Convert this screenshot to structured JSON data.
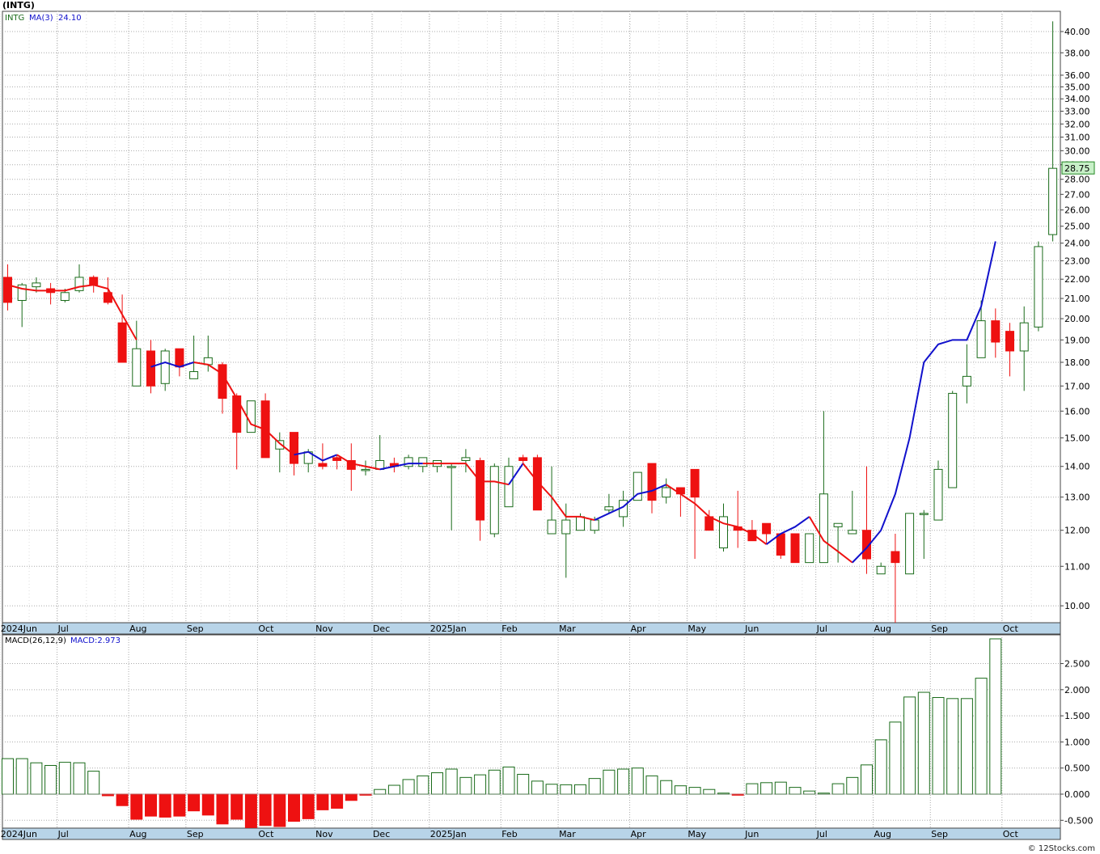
{
  "page": {
    "title": "(INTG)",
    "credit": "© 12Stocks.com"
  },
  "colors": {
    "up": "#1a6b1a",
    "down": "#ee1111",
    "ma_up": "#1111cc",
    "ma_down": "#ee1111",
    "grid": "#aaaaaa",
    "axis_band": "#b8d4e8",
    "last_price_bg": "#c8f0c8"
  },
  "chart_data": [
    {
      "type": "candlestick",
      "legend": {
        "symbol": "INTG",
        "ma_label": "MA(3)",
        "ma_value": "24.10"
      },
      "last_price": "28.75",
      "y_scale": "log",
      "ylim": [
        9.6,
        42.0
      ],
      "y_ticks": [
        "10.00",
        "11.00",
        "12.00",
        "13.00",
        "14.00",
        "15.00",
        "16.00",
        "17.00",
        "18.00",
        "19.00",
        "20.00",
        "21.00",
        "22.00",
        "23.00",
        "24.00",
        "25.00",
        "26.00",
        "27.00",
        "28.00",
        "29.00",
        "30.00",
        "31.00",
        "32.00",
        "33.00",
        "34.00",
        "35.00",
        "36.00",
        "38.00",
        "40.00"
      ],
      "x_labels": [
        "2024Jun",
        "Jul",
        "Aug",
        "Sep",
        "Oct",
        "Nov",
        "Dec",
        "2025Jan",
        "Feb",
        "Mar",
        "Apr",
        "May",
        "Jun",
        "Jul",
        "Aug",
        "Sep",
        "Oct"
      ],
      "x_label_weeks": [
        0,
        4,
        9,
        13,
        18,
        22,
        26,
        30,
        35,
        39,
        44,
        48,
        52,
        57,
        61,
        65,
        70
      ],
      "candles": [
        {
          "o": 22.1,
          "h": 22.8,
          "l": 20.4,
          "c": 20.8
        },
        {
          "o": 20.9,
          "h": 21.8,
          "l": 19.6,
          "c": 21.7
        },
        {
          "o": 21.6,
          "h": 22.1,
          "l": 21.3,
          "c": 21.8
        },
        {
          "o": 21.5,
          "h": 21.8,
          "l": 20.7,
          "c": 21.3
        },
        {
          "o": 20.9,
          "h": 21.5,
          "l": 20.8,
          "c": 21.3
        },
        {
          "o": 21.4,
          "h": 22.8,
          "l": 21.3,
          "c": 22.1
        },
        {
          "o": 22.1,
          "h": 22.2,
          "l": 21.3,
          "c": 21.7
        },
        {
          "o": 21.3,
          "h": 22.1,
          "l": 20.7,
          "c": 20.8
        },
        {
          "o": 19.8,
          "h": 21.2,
          "l": 18.0,
          "c": 18.0
        },
        {
          "o": 17.0,
          "h": 19.9,
          "l": 17.0,
          "c": 18.6
        },
        {
          "o": 18.5,
          "h": 19.0,
          "l": 16.7,
          "c": 17.0
        },
        {
          "o": 17.1,
          "h": 18.6,
          "l": 16.8,
          "c": 18.5
        },
        {
          "o": 18.6,
          "h": 18.6,
          "l": 17.4,
          "c": 17.8
        },
        {
          "o": 17.3,
          "h": 19.2,
          "l": 17.3,
          "c": 17.6
        },
        {
          "o": 17.9,
          "h": 19.2,
          "l": 17.6,
          "c": 18.2
        },
        {
          "o": 17.9,
          "h": 18.0,
          "l": 15.9,
          "c": 16.5
        },
        {
          "o": 16.6,
          "h": 16.7,
          "l": 13.9,
          "c": 15.2
        },
        {
          "o": 15.2,
          "h": 16.4,
          "l": 15.2,
          "c": 16.4
        },
        {
          "o": 16.4,
          "h": 16.7,
          "l": 14.3,
          "c": 14.3
        },
        {
          "o": 14.6,
          "h": 15.2,
          "l": 13.8,
          "c": 14.9
        },
        {
          "o": 15.2,
          "h": 15.2,
          "l": 13.7,
          "c": 14.1
        },
        {
          "o": 14.1,
          "h": 14.6,
          "l": 13.8,
          "c": 14.5
        },
        {
          "o": 14.1,
          "h": 14.8,
          "l": 13.9,
          "c": 14.0
        },
        {
          "o": 14.3,
          "h": 14.4,
          "l": 13.9,
          "c": 14.2
        },
        {
          "o": 14.2,
          "h": 14.8,
          "l": 13.2,
          "c": 13.9
        },
        {
          "o": 13.9,
          "h": 14.2,
          "l": 13.7,
          "c": 13.9
        },
        {
          "o": 13.9,
          "h": 15.1,
          "l": 13.9,
          "c": 14.2
        },
        {
          "o": 14.1,
          "h": 14.3,
          "l": 13.8,
          "c": 14.0
        },
        {
          "o": 14.0,
          "h": 14.4,
          "l": 13.9,
          "c": 14.3
        },
        {
          "o": 14.0,
          "h": 14.3,
          "l": 13.8,
          "c": 14.3
        },
        {
          "o": 14.0,
          "h": 14.2,
          "l": 13.8,
          "c": 14.2
        },
        {
          "o": 14.0,
          "h": 14.1,
          "l": 12.0,
          "c": 14.0
        },
        {
          "o": 14.2,
          "h": 14.6,
          "l": 13.8,
          "c": 14.3
        },
        {
          "o": 14.2,
          "h": 14.3,
          "l": 11.7,
          "c": 12.3
        },
        {
          "o": 11.9,
          "h": 14.1,
          "l": 11.8,
          "c": 14.0
        },
        {
          "o": 12.7,
          "h": 14.3,
          "l": 12.7,
          "c": 14.0
        },
        {
          "o": 14.3,
          "h": 14.4,
          "l": 14.1,
          "c": 14.2
        },
        {
          "o": 14.3,
          "h": 14.4,
          "l": 12.6,
          "c": 12.6
        },
        {
          "o": 11.9,
          "h": 14.0,
          "l": 11.9,
          "c": 12.3
        },
        {
          "o": 11.9,
          "h": 12.8,
          "l": 10.7,
          "c": 12.3
        },
        {
          "o": 12.0,
          "h": 12.5,
          "l": 12.0,
          "c": 12.4
        },
        {
          "o": 12.0,
          "h": 12.4,
          "l": 11.9,
          "c": 12.3
        },
        {
          "o": 12.6,
          "h": 13.1,
          "l": 12.5,
          "c": 12.7
        },
        {
          "o": 12.4,
          "h": 13.2,
          "l": 12.1,
          "c": 12.9
        },
        {
          "o": 12.9,
          "h": 13.8,
          "l": 12.9,
          "c": 13.8
        },
        {
          "o": 14.1,
          "h": 14.1,
          "l": 12.5,
          "c": 12.9
        },
        {
          "o": 13.0,
          "h": 13.6,
          "l": 12.8,
          "c": 13.3
        },
        {
          "o": 13.3,
          "h": 13.3,
          "l": 12.4,
          "c": 13.1
        },
        {
          "o": 13.9,
          "h": 13.9,
          "l": 11.2,
          "c": 13.0
        },
        {
          "o": 12.4,
          "h": 12.6,
          "l": 12.0,
          "c": 12.0
        },
        {
          "o": 11.5,
          "h": 12.8,
          "l": 11.4,
          "c": 12.4
        },
        {
          "o": 12.1,
          "h": 13.2,
          "l": 11.5,
          "c": 12.0
        },
        {
          "o": 12.0,
          "h": 12.3,
          "l": 11.8,
          "c": 11.7
        },
        {
          "o": 12.2,
          "h": 12.2,
          "l": 11.6,
          "c": 11.9
        },
        {
          "o": 11.9,
          "h": 11.9,
          "l": 11.2,
          "c": 11.3
        },
        {
          "o": 11.9,
          "h": 11.9,
          "l": 11.1,
          "c": 11.1
        },
        {
          "o": 11.1,
          "h": 11.9,
          "l": 11.1,
          "c": 11.9
        },
        {
          "o": 11.1,
          "h": 16.0,
          "l": 11.1,
          "c": 13.1
        },
        {
          "o": 12.1,
          "h": 12.2,
          "l": 11.1,
          "c": 12.2
        },
        {
          "o": 11.9,
          "h": 13.2,
          "l": 11.9,
          "c": 12.0
        },
        {
          "o": 12.0,
          "h": 14.0,
          "l": 10.8,
          "c": 11.2
        },
        {
          "o": 10.8,
          "h": 11.1,
          "l": 10.8,
          "c": 11.0
        },
        {
          "o": 11.4,
          "h": 11.9,
          "l": 9.6,
          "c": 11.1
        },
        {
          "o": 10.8,
          "h": 12.5,
          "l": 10.8,
          "c": 12.5
        },
        {
          "o": 12.5,
          "h": 12.6,
          "l": 11.2,
          "c": 12.5
        },
        {
          "o": 12.3,
          "h": 14.2,
          "l": 12.3,
          "c": 13.9
        },
        {
          "o": 13.3,
          "h": 16.8,
          "l": 13.3,
          "c": 16.7
        },
        {
          "o": 17.0,
          "h": 18.8,
          "l": 16.3,
          "c": 17.4
        },
        {
          "o": 18.2,
          "h": 20.9,
          "l": 18.2,
          "c": 19.9
        },
        {
          "o": 19.9,
          "h": 20.5,
          "l": 18.2,
          "c": 18.9
        },
        {
          "o": 19.4,
          "h": 19.8,
          "l": 17.4,
          "c": 18.5
        },
        {
          "o": 18.5,
          "h": 20.6,
          "l": 16.8,
          "c": 19.8
        },
        {
          "o": 19.6,
          "h": 24.1,
          "l": 19.4,
          "c": 23.8
        },
        {
          "o": 24.5,
          "h": 41.0,
          "l": 24.1,
          "c": 28.75
        }
      ],
      "ma_series": [
        {
          "color": "red",
          "points": [
            [
              0,
              21.7
            ],
            [
              1,
              21.5
            ],
            [
              2,
              21.4
            ],
            [
              3,
              21.4
            ],
            [
              4,
              21.4
            ],
            [
              5,
              21.6
            ],
            [
              6,
              21.7
            ],
            [
              7,
              21.5
            ],
            [
              8,
              20.2
            ],
            [
              9,
              19.0
            ]
          ]
        },
        {
          "color": "blue",
          "points": [
            [
              10,
              17.8
            ],
            [
              11,
              18.0
            ],
            [
              12,
              17.8
            ],
            [
              13,
              18.0
            ]
          ]
        },
        {
          "color": "red",
          "points": [
            [
              13,
              18.0
            ],
            [
              14,
              17.9
            ],
            [
              15,
              17.5
            ],
            [
              16,
              16.5
            ],
            [
              17,
              15.5
            ],
            [
              18,
              15.3
            ],
            [
              19,
              14.8
            ],
            [
              20,
              14.4
            ]
          ]
        },
        {
          "color": "blue",
          "points": [
            [
              20,
              14.4
            ],
            [
              21,
              14.5
            ],
            [
              22,
              14.2
            ],
            [
              23,
              14.4
            ]
          ]
        },
        {
          "color": "red",
          "points": [
            [
              23,
              14.4
            ],
            [
              24,
              14.1
            ],
            [
              25,
              14.0
            ],
            [
              26,
              13.9
            ]
          ]
        },
        {
          "color": "blue",
          "points": [
            [
              26,
              13.9
            ],
            [
              27,
              14.0
            ],
            [
              28,
              14.1
            ],
            [
              29,
              14.1
            ]
          ]
        },
        {
          "color": "red",
          "points": [
            [
              29,
              14.1
            ],
            [
              30,
              14.1
            ],
            [
              31,
              14.1
            ],
            [
              32,
              14.1
            ],
            [
              33,
              13.5
            ],
            [
              34,
              13.5
            ],
            [
              35,
              13.4
            ]
          ]
        },
        {
          "color": "blue",
          "points": [
            [
              35,
              13.4
            ],
            [
              36,
              14.1
            ]
          ]
        },
        {
          "color": "red",
          "points": [
            [
              36,
              14.1
            ],
            [
              37,
              13.5
            ],
            [
              38,
              13.0
            ],
            [
              39,
              12.4
            ],
            [
              40,
              12.4
            ],
            [
              41,
              12.3
            ]
          ]
        },
        {
          "color": "blue",
          "points": [
            [
              41,
              12.3
            ],
            [
              42,
              12.5
            ],
            [
              43,
              12.7
            ],
            [
              44,
              13.1
            ],
            [
              45,
              13.2
            ],
            [
              46,
              13.4
            ]
          ]
        },
        {
          "color": "red",
          "points": [
            [
              46,
              13.4
            ],
            [
              47,
              13.1
            ],
            [
              48,
              12.8
            ],
            [
              49,
              12.4
            ],
            [
              50,
              12.2
            ],
            [
              51,
              12.1
            ],
            [
              52,
              11.9
            ],
            [
              53,
              11.6
            ]
          ]
        },
        {
          "color": "blue",
          "points": [
            [
              53,
              11.6
            ],
            [
              54,
              11.9
            ],
            [
              55,
              12.1
            ],
            [
              56,
              12.4
            ]
          ]
        },
        {
          "color": "red",
          "points": [
            [
              56,
              12.4
            ],
            [
              57,
              11.7
            ],
            [
              58,
              11.4
            ],
            [
              59,
              11.1
            ]
          ]
        },
        {
          "color": "blue",
          "points": [
            [
              59,
              11.1
            ],
            [
              60,
              11.5
            ],
            [
              61,
              12.0
            ],
            [
              62,
              13.1
            ],
            [
              63,
              15.0
            ],
            [
              64,
              18.0
            ],
            [
              65,
              18.8
            ],
            [
              66,
              19.0
            ],
            [
              67,
              19.0
            ],
            [
              68,
              20.6
            ],
            [
              69,
              24.1
            ]
          ]
        }
      ]
    },
    {
      "type": "bar",
      "legend": {
        "label": "MACD(26,12,9)",
        "value_label": "MACD:2.973"
      },
      "ylim": [
        -0.65,
        3.05
      ],
      "y_ticks": [
        "-0.500",
        "0.000",
        "0.500",
        "1.000",
        "1.500",
        "2.000",
        "2.500"
      ],
      "x_labels": [
        "2024Jun",
        "Jul",
        "Aug",
        "Sep",
        "Oct",
        "Nov",
        "Dec",
        "2025Jan",
        "Feb",
        "Mar",
        "Apr",
        "May",
        "Jun",
        "Jul",
        "Aug",
        "Sep",
        "Oct"
      ],
      "values": [
        0.68,
        0.68,
        0.6,
        0.55,
        0.61,
        0.6,
        0.44,
        -0.03,
        -0.22,
        -0.48,
        -0.42,
        -0.44,
        -0.42,
        -0.32,
        -0.4,
        -0.57,
        -0.48,
        -0.64,
        -0.6,
        -0.62,
        -0.52,
        -0.47,
        -0.3,
        -0.27,
        -0.12,
        -0.02,
        0.09,
        0.17,
        0.28,
        0.35,
        0.41,
        0.48,
        0.32,
        0.37,
        0.46,
        0.52,
        0.38,
        0.25,
        0.19,
        0.18,
        0.18,
        0.3,
        0.46,
        0.48,
        0.5,
        0.35,
        0.26,
        0.16,
        0.13,
        0.09,
        0.02,
        -0.02,
        0.2,
        0.22,
        0.23,
        0.13,
        0.06,
        0.02,
        0.2,
        0.32,
        0.56,
        1.04,
        1.38,
        1.86,
        1.95,
        1.85,
        1.83,
        1.83,
        2.22,
        2.973
      ]
    }
  ]
}
